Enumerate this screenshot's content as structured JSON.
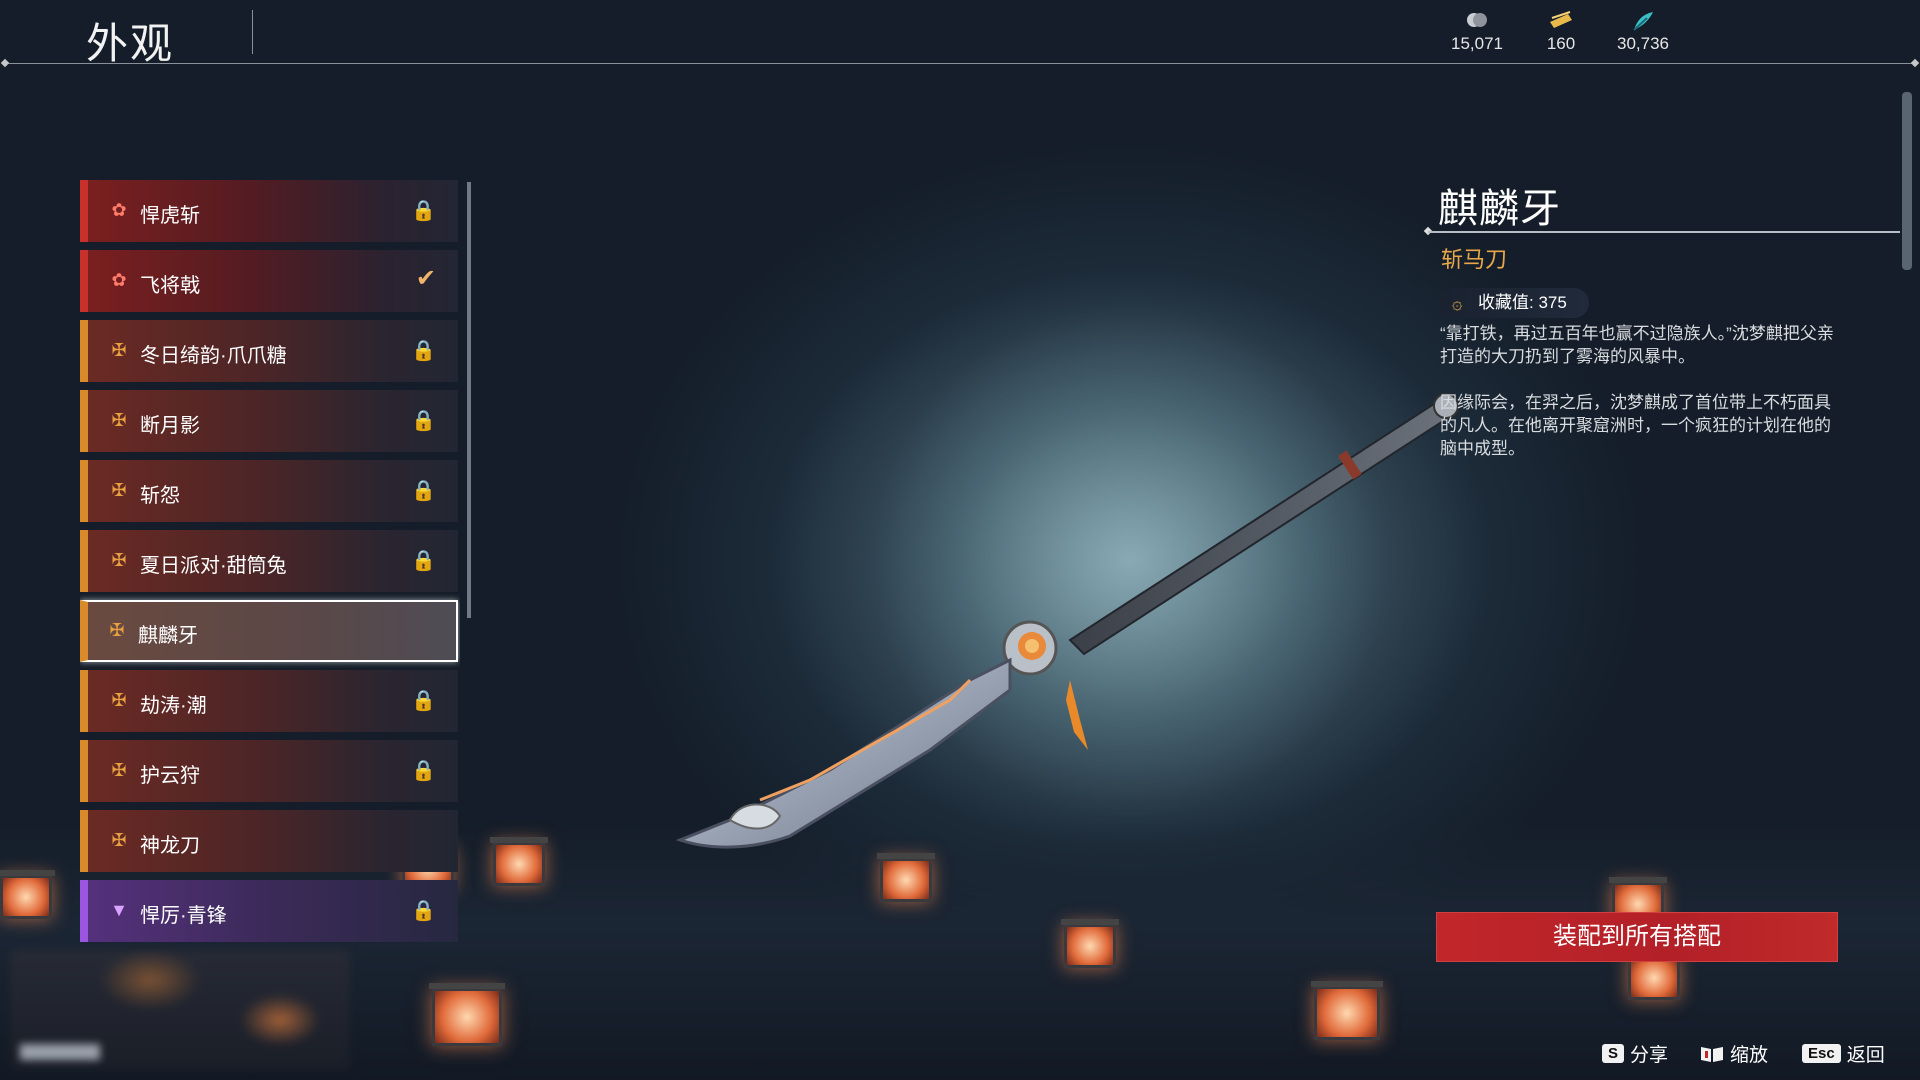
{
  "header": {
    "title": "外观",
    "currencies": [
      {
        "icon": "coin-icon",
        "value": "15,071"
      },
      {
        "icon": "ticket-icon",
        "value": "160"
      },
      {
        "icon": "feather-icon",
        "value": "30,736"
      }
    ]
  },
  "list": {
    "items": [
      {
        "label": "悍虎斩",
        "rarity": "red",
        "state": "locked"
      },
      {
        "label": "飞将戟",
        "rarity": "red",
        "state": "equipped"
      },
      {
        "label": "冬日绮韵·爪爪糖",
        "rarity": "orange",
        "state": "locked"
      },
      {
        "label": "断月影",
        "rarity": "orange",
        "state": "locked"
      },
      {
        "label": "斩怨",
        "rarity": "orange",
        "state": "locked"
      },
      {
        "label": "夏日派对·甜筒兔",
        "rarity": "orange",
        "state": "locked"
      },
      {
        "label": "麒麟牙",
        "rarity": "orange",
        "state": "selected"
      },
      {
        "label": "劫涛·潮",
        "rarity": "orange",
        "state": "locked"
      },
      {
        "label": "护云狩",
        "rarity": "orange",
        "state": "locked"
      },
      {
        "label": "神龙刀",
        "rarity": "orange",
        "state": "none"
      },
      {
        "label": "悍厉·青锋",
        "rarity": "purple",
        "state": "locked"
      }
    ],
    "lock_glyph": "🔒",
    "check_glyph": "✔"
  },
  "detail": {
    "title": "麒麟牙",
    "type": "斩马刀",
    "collection_label": "收藏值: 375",
    "desc_1": "“靠打铁，再过五百年也赢不过隐族人。”沈梦麒把父亲打造的大刀扔到了雾海的风暴中。",
    "desc_2": "因缘际会，在羿之后，沈梦麒成了首位带上不朽面具的凡人。在他离开聚窟洲时，一个疯狂的计划在他的脑中成型。",
    "equip_button": "装配到所有搭配"
  },
  "hints": [
    {
      "key": "S",
      "label": "分享"
    },
    {
      "key": "book",
      "label": "缩放"
    },
    {
      "key": "Esc",
      "label": "返回"
    }
  ],
  "colors": {
    "accent_red": "#c1262a",
    "rarity_orange": "#d98a2a",
    "rarity_red": "#c8302c",
    "rarity_purple": "#9a56e0",
    "type_gold": "#e8a84a"
  }
}
